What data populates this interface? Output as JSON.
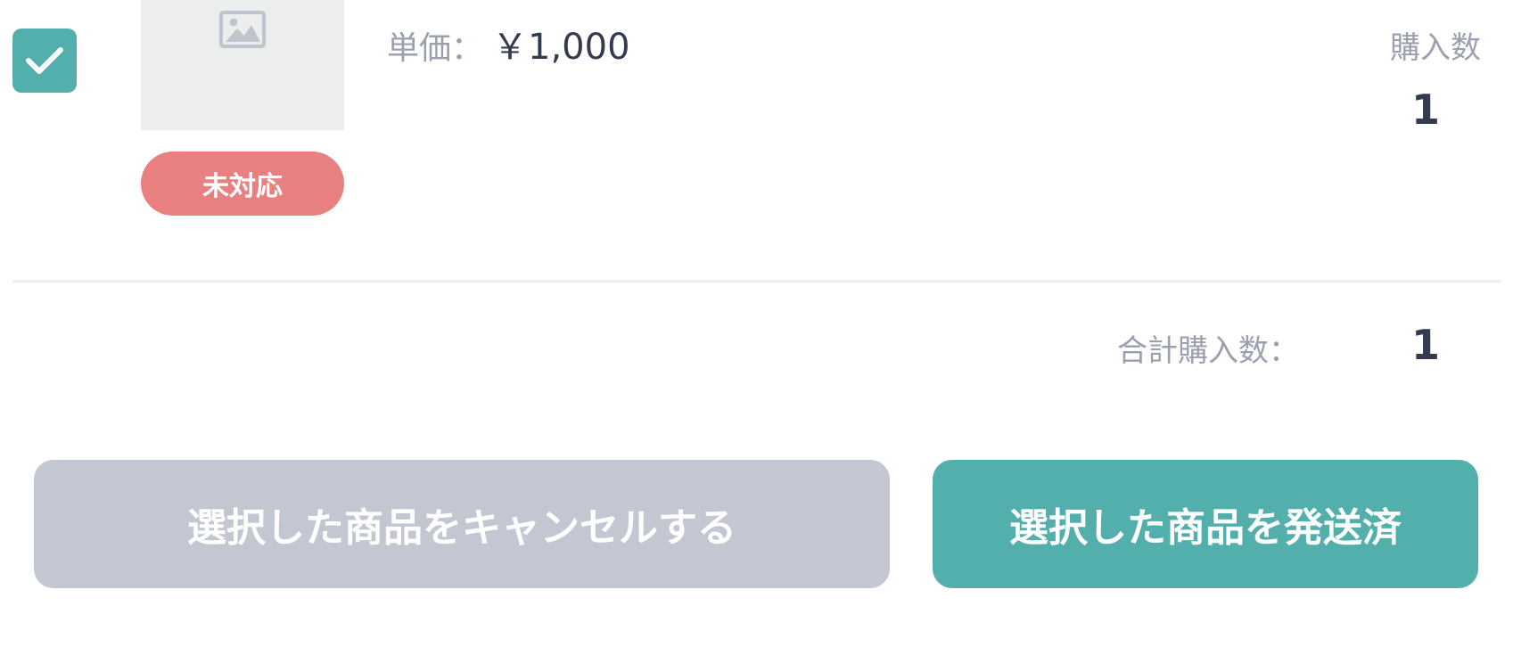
{
  "item": {
    "checked": true,
    "image_icon": "image-placeholder-icon",
    "status_badge": "未対応",
    "price_label": "単価：",
    "price_value": "￥1,000",
    "quantity_label": "購入数",
    "quantity_value": "1"
  },
  "summary": {
    "total_label": "合計購入数：",
    "total_value": "1"
  },
  "actions": {
    "cancel_label": "選択した商品をキャンセルする",
    "ship_label": "選択した商品を発送済"
  },
  "colors": {
    "accent": "#52afac",
    "status_unhandled": "#e8807f",
    "disabled_button": "#c3c7d1",
    "text_muted": "#9aa0ad",
    "text_dark": "#343a4f"
  }
}
